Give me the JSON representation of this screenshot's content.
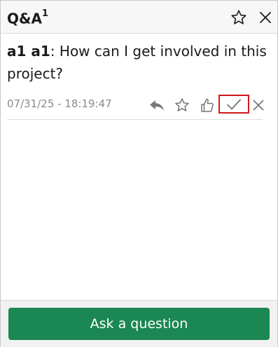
{
  "header": {
    "title": "Q&A",
    "count": "1",
    "star_icon": "star-outline-icon",
    "close_icon": "close-icon"
  },
  "question": {
    "author": "a1 a1",
    "separator": ":",
    "text": " How can I get involved in this project?",
    "timestamp": "07/31/25 - 18:19:47"
  },
  "actions": [
    {
      "name": "reply",
      "icon": "reply-icon"
    },
    {
      "name": "star",
      "icon": "star-outline-icon"
    },
    {
      "name": "like",
      "icon": "thumbs-up-icon"
    },
    {
      "name": "mark-resolved",
      "icon": "checkmark-icon",
      "highlighted": true
    },
    {
      "name": "delete",
      "icon": "close-icon"
    }
  ],
  "footer": {
    "ask_label": "Ask a question"
  },
  "colors": {
    "accent_button": "#1b8752",
    "highlight_border": "#d0191d",
    "timestamp_text": "#8a8a8a",
    "icon_gray": "#777777"
  }
}
